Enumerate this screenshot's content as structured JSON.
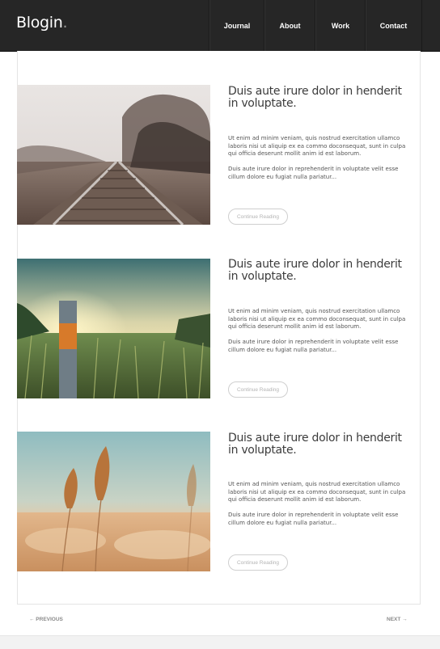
{
  "site": {
    "logo": "Blogin",
    "logo_dot": "."
  },
  "nav": {
    "journal": "Journal",
    "about": "About",
    "work": "Work",
    "contact": "Contact"
  },
  "posts": [
    {
      "title": "Duis aute irure dolor in henderit in voluptate.",
      "p1": "Ut enim ad minim veniam, quis nostrud exercitation ullamco laboris nisi ut aliquip ex ea commo doconsequat, sunt in culpa qui officia deserunt mollit anim id est laborum.",
      "p2": "Duis aute irure dolor in reprehenderit in voluptate velit esse cillum dolore eu fugiat nulla pariatur...",
      "button": "Continue Reading"
    },
    {
      "title": "Duis aute irure dolor in henderit in voluptate.",
      "p1": "Ut enim ad minim veniam, quis nostrud exercitation ullamco laboris nisi ut aliquip ex ea commo doconsequat, sunt in culpa qui officia deserunt mollit anim id est laborum.",
      "p2": "Duis aute irure dolor in reprehenderit in voluptate velit esse cillum dolore eu fugiat nulla pariatur...",
      "button": "Continue Reading"
    },
    {
      "title": "Duis aute irure dolor in henderit in voluptate.",
      "p1": "Ut enim ad minim veniam, quis nostrud exercitation ullamco laboris nisi ut aliquip ex ea commo doconsequat, sunt in culpa qui officia deserunt mollit anim id est laborum.",
      "p2": "Duis aute irure dolor in reprehenderit in voluptate velit esse cillum dolore eu fugiat nulla pariatur...",
      "button": "Continue Reading"
    }
  ],
  "pagination": {
    "previous": "← PREVIOUS",
    "next": "NEXT →"
  },
  "colors": {
    "header_bg": "#262626",
    "text": "#3c3c3c",
    "muted": "#b4b4b4"
  }
}
